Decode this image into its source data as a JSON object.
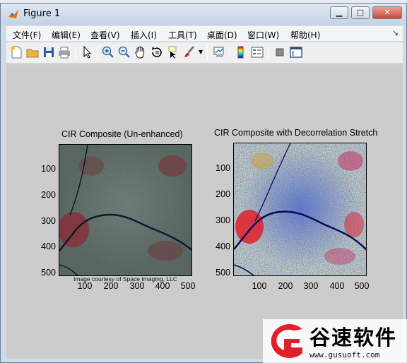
{
  "window": {
    "title": "Figure 1"
  },
  "window_controls": {
    "minimize": "▁",
    "maximize": "□",
    "close": "✕"
  },
  "menu": [
    {
      "label": "文件(F)"
    },
    {
      "label": "编辑(E)"
    },
    {
      "label": "查看(V)"
    },
    {
      "label": "插入(I)"
    },
    {
      "label": "工具(T)"
    },
    {
      "label": "桌面(D)"
    },
    {
      "label": "窗口(W)"
    },
    {
      "label": "帮助(H)"
    }
  ],
  "toolbar": [
    "new-figure-icon",
    "open-file-icon",
    "save-icon",
    "print-icon",
    "select-arrow-icon",
    "zoom-in-icon",
    "zoom-out-icon",
    "pan-hand-icon",
    "rotate-3d-icon",
    "data-cursor-icon",
    "brush-icon",
    "link-plot-icon",
    "colorbar-icon",
    "legend-icon",
    "hide-plot-tools-icon",
    "show-plot-tools-icon"
  ],
  "axes_left": {
    "title": "CIR Composite (Un-enhanced)",
    "yticks": [
      "100",
      "200",
      "300",
      "400",
      "500"
    ],
    "xticks": [
      "100",
      "200",
      "300",
      "400",
      "500"
    ],
    "credit": "Image courtesy of Space Imaging, LLC"
  },
  "axes_right": {
    "title": "CIR Composite with Decorrelation Stretch",
    "yticks": [
      "100",
      "200",
      "300",
      "400",
      "500"
    ],
    "xticks": [
      "100",
      "200",
      "300",
      "400",
      "500"
    ]
  },
  "watermark": {
    "name": "谷速软件",
    "url": "www.gusuoft.com"
  },
  "colors": {
    "figure_bg": "#cccccc",
    "accent_red": "#e0202a"
  }
}
